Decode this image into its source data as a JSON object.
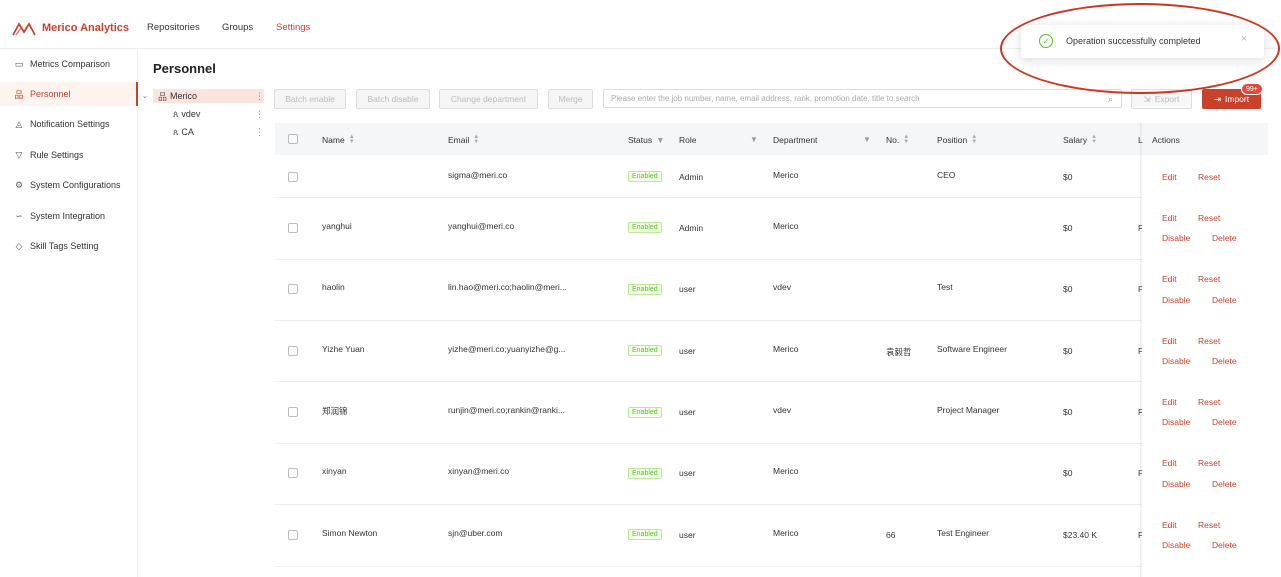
{
  "app": {
    "name": "Merico Analytics"
  },
  "topnav": [
    "Repositories",
    "Groups",
    "Settings"
  ],
  "sidebar": {
    "items": [
      {
        "label": "Metrics Comparison",
        "icon": "compare-icon"
      },
      {
        "label": "Personnel",
        "icon": "org-icon",
        "active": true
      },
      {
        "label": "Notification Settings",
        "icon": "bell-icon"
      },
      {
        "label": "Rule Settings",
        "icon": "filter-icon"
      },
      {
        "label": "System Configurations",
        "icon": "gear-icon"
      },
      {
        "label": "System Integration",
        "icon": "link-icon"
      },
      {
        "label": "Skill Tags Setting",
        "icon": "tag-icon"
      }
    ]
  },
  "page": {
    "title": "Personnel"
  },
  "tree": [
    "Merico",
    "vdev",
    "CA"
  ],
  "toolbar": {
    "batch_enable": "Batch enable",
    "batch_disable": "Batch disable",
    "change_department": "Change department",
    "merge": "Merge",
    "search_placeholder": "Please enter the job number, name, email address, rank, promotion date, title to search",
    "export": "Export",
    "import": "Import",
    "import_badge": "99+"
  },
  "table": {
    "columns": [
      "Name",
      "Email",
      "Status",
      "Role",
      "Department",
      "No.",
      "Position",
      "Salary",
      "L",
      "Actions"
    ],
    "rows": [
      {
        "name": "",
        "email": "sigma@meri.co",
        "status": "Enabled",
        "role": "Admin",
        "department": "Merico",
        "no": "",
        "position": "CEO",
        "salary": "$0",
        "extra": "",
        "actions": [
          "Edit",
          "Reset"
        ]
      },
      {
        "name": "yanghui",
        "email": "yanghui@meri.co",
        "status": "Enabled",
        "role": "Admin",
        "department": "Merico",
        "no": "",
        "position": "",
        "salary": "$0",
        "extra": "F",
        "actions": [
          "Edit",
          "Reset",
          "Disable",
          "Delete"
        ]
      },
      {
        "name": "haolin",
        "email": "lin.hao@meri.co;haolin@meri...",
        "status": "Enabled",
        "role": "user",
        "department": "vdev",
        "no": "",
        "position": "Test",
        "salary": "$0",
        "extra": "F",
        "actions": [
          "Edit",
          "Reset",
          "Disable",
          "Delete"
        ]
      },
      {
        "name": "Yizhe Yuan",
        "email": "yizhe@meri.co;yuanyizhe@g...",
        "status": "Enabled",
        "role": "user",
        "department": "Merico",
        "no": "袁毅哲",
        "position": "Software Engineer",
        "salary": "$0",
        "extra": "F",
        "actions": [
          "Edit",
          "Reset",
          "Disable",
          "Delete"
        ]
      },
      {
        "name": "郑润锦",
        "email": "runjin@meri.co;rankin@ranki...",
        "status": "Enabled",
        "role": "user",
        "department": "vdev",
        "no": "",
        "position": "Project Manager",
        "salary": "$0",
        "extra": "F",
        "actions": [
          "Edit",
          "Reset",
          "Disable",
          "Delete"
        ]
      },
      {
        "name": "xinyan",
        "email": "xinyan@meri.co",
        "status": "Enabled",
        "role": "user",
        "department": "Merico",
        "no": "",
        "position": "",
        "salary": "$0",
        "extra": "F",
        "actions": [
          "Edit",
          "Reset",
          "Disable",
          "Delete"
        ]
      },
      {
        "name": "Simon Newton",
        "email": "sjn@uber.com",
        "status": "Enabled",
        "role": "user",
        "department": "Merico",
        "no": "66",
        "position": "Test Engineer",
        "salary": "$23.40 K",
        "extra": "F",
        "actions": [
          "Edit",
          "Reset",
          "Disable",
          "Delete"
        ]
      }
    ]
  },
  "toast": {
    "message": "Operation successfully completed",
    "close": "×"
  },
  "colors": {
    "accent": "#c8412b",
    "success": "#52c41a",
    "annotation": "#d0341f"
  }
}
